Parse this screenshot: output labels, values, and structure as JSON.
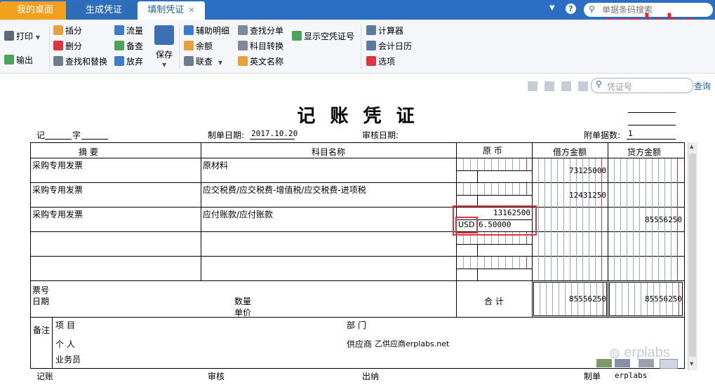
{
  "tabs": [
    {
      "label": "我的桌面"
    },
    {
      "label": "生成凭证"
    },
    {
      "label": "填制凭证"
    }
  ],
  "header_right": {
    "search_placeholder": "单据条码搜索",
    "watermark": "erplabs"
  },
  "toolbar": {
    "print": "打印",
    "export": "输出",
    "insert": "插分",
    "delete": "删分",
    "find_replace": "查找和替换",
    "flow": "流量",
    "backup": "备查",
    "discard": "放弃",
    "save": "保存",
    "aux_detail": "辅助明细",
    "balance": "余额",
    "linked_query": "联查",
    "find_entry": "查找分单",
    "subject_convert": "科目转换",
    "english_name": "英文名称",
    "show_empty_no": "显示空凭证号",
    "calculator": "计算器",
    "accounting_calendar": "会计日历",
    "options": "选项"
  },
  "nav": {
    "voucher_no_placeholder": "凭证号",
    "query": "查询"
  },
  "voucher": {
    "title": "记 账 凭 证",
    "type_char": "记",
    "zi": "字",
    "date_label": "制单日期:",
    "date_value": "2017.10.20",
    "audit_date_label": "审核日期:",
    "attach_label": "附单据数:",
    "attach_value": "1",
    "columns": {
      "summary": "摘 要",
      "subject": "科目名称",
      "original": "原 币",
      "debit": "借方金额",
      "credit": "贷方金额"
    },
    "rows": [
      {
        "summary": "采购专用发票",
        "subject": "原材料",
        "orig_amount": "",
        "currency": "",
        "rate": "",
        "debit": "73125000",
        "credit": ""
      },
      {
        "summary": "采购专用发票",
        "subject": "应交税费/应交税费-增值税/应交税费-进项税",
        "orig_amount": "",
        "currency": "",
        "rate": "",
        "debit": "12431250",
        "credit": ""
      },
      {
        "summary": "采购专用发票",
        "subject": "应付账款/应付账款",
        "orig_amount": "13162500",
        "currency": "USD",
        "rate": "6.50000",
        "debit": "",
        "credit": "85556250"
      },
      {
        "summary": "",
        "subject": "",
        "orig_amount": "",
        "currency": "",
        "rate": "",
        "debit": "",
        "credit": ""
      },
      {
        "summary": "",
        "subject": "",
        "orig_amount": "",
        "currency": "",
        "rate": "",
        "debit": "",
        "credit": ""
      }
    ],
    "footer": {
      "bill_no": "票号",
      "date": "日期",
      "quantity": "数量",
      "unit_price": "单价",
      "total_label": "合 计",
      "total_debit": "85556250",
      "total_credit": "85556250"
    },
    "remarks": {
      "label": "备注",
      "project": "项 目",
      "department": "部 门",
      "person": "个 人",
      "supplier_label": "供应商",
      "supplier_value": "乙供应商erplabs.net",
      "salesman": "业务员"
    },
    "signatures": {
      "bookkeeping": "记账",
      "audit": "审核",
      "cashier": "出纳",
      "maker": "制单",
      "maker_name": "erplabs"
    }
  },
  "bottom_watermark": "erplabs",
  "colors": {
    "tab_bar": "#2a6fc4",
    "active_tab_orange": "#f3a01e",
    "highlight_red": "#d9363e",
    "watermark_red": "#e8252e"
  }
}
